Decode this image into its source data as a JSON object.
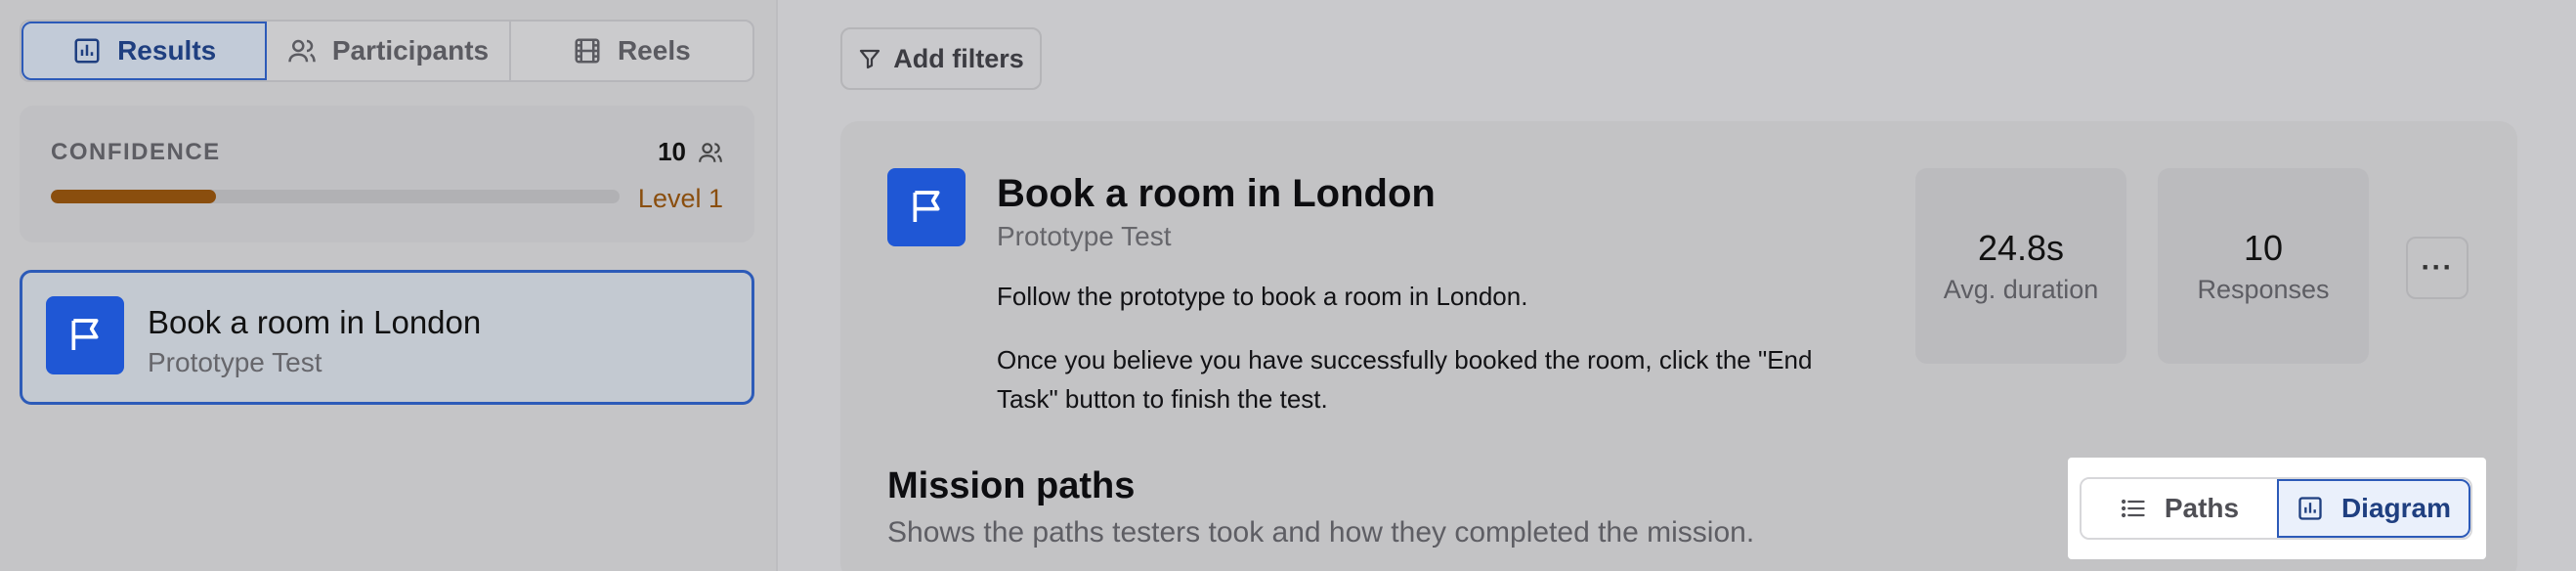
{
  "sidebar": {
    "tabs": [
      {
        "label": "Results",
        "icon": "bar-chart-icon",
        "active": true
      },
      {
        "label": "Participants",
        "icon": "users-icon",
        "active": false
      },
      {
        "label": "Reels",
        "icon": "film-icon",
        "active": false
      }
    ],
    "confidence": {
      "label": "CONFIDENCE",
      "count": "10",
      "level": "Level 1",
      "progress_fraction": 0.29,
      "bar_color": "#8a4e0e"
    },
    "task": {
      "title": "Book a room in London",
      "subtitle": "Prototype Test",
      "icon": "flag-icon"
    }
  },
  "main": {
    "add_filters_label": "Add filters",
    "task": {
      "title": "Book a room in London",
      "subtitle": "Prototype Test",
      "description_1": "Follow the prototype to book a room in London.",
      "description_2": "Once you believe you have successfully booked the room, click the \"End Task\" button to finish the test."
    },
    "stats": [
      {
        "value": "24.8s",
        "label": "Avg. duration"
      },
      {
        "value": "10",
        "label": "Responses"
      }
    ],
    "more_label": "···",
    "mission_paths": {
      "title": "Mission paths",
      "subtitle": "Shows the paths testers took and how they completed the mission."
    },
    "view_toggle": {
      "paths_label": "Paths",
      "diagram_label": "Diagram",
      "selected": "Diagram"
    }
  },
  "colors": {
    "accent": "#1f57d5",
    "active_border": "#2c5ab8",
    "confidence": "#8a4e0e"
  }
}
